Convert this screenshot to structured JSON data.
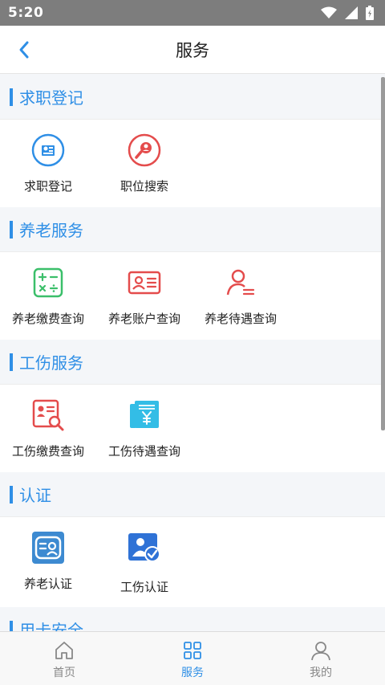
{
  "status_bar": {
    "time": "5:20"
  },
  "header": {
    "title": "服务"
  },
  "sections": [
    {
      "title": "求职登记",
      "items": [
        {
          "label": "求职登记",
          "icon": "job-register-icon"
        },
        {
          "label": "职位搜索",
          "icon": "job-search-icon"
        }
      ]
    },
    {
      "title": "养老服务",
      "items": [
        {
          "label": "养老缴费查询",
          "icon": "calculator-icon"
        },
        {
          "label": "养老账户查询",
          "icon": "id-card-icon"
        },
        {
          "label": "养老待遇查询",
          "icon": "person-list-icon"
        }
      ]
    },
    {
      "title": "工伤服务",
      "items": [
        {
          "label": "工伤缴费查询",
          "icon": "document-search-icon"
        },
        {
          "label": "工伤待遇查询",
          "icon": "yuan-document-icon"
        }
      ]
    },
    {
      "title": "认证",
      "items": [
        {
          "label": "养老认证",
          "icon": "pension-auth-icon"
        },
        {
          "label": "工伤认证",
          "icon": "injury-auth-icon"
        }
      ]
    },
    {
      "title": "用卡安全"
    }
  ],
  "tabs": [
    {
      "label": "首页",
      "icon": "home-icon"
    },
    {
      "label": "服务",
      "icon": "grid-icon"
    },
    {
      "label": "我的",
      "icon": "person-icon"
    }
  ],
  "colors": {
    "accent": "#2f8fe6",
    "red": "#e44c4c",
    "green": "#3bbf6a",
    "cyan": "#33bde6"
  }
}
